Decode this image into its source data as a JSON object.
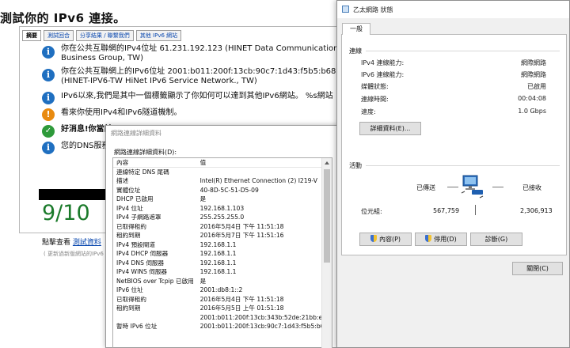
{
  "web": {
    "title": "測試你的 IPv6 連接。",
    "tabs": [
      "摘要",
      "測試回合",
      "分享結果 / 聯繫我們",
      "其他 IPv6 網站"
    ],
    "results": [
      {
        "icon": "info",
        "text": "你在公共互聯網的IPv4位址 61.231.192.123 (HINET Data Communication Business Group, TW)"
      },
      {
        "icon": "info",
        "text": "你在公共互聯網上的IPv6位址 2001:b011:200f:13cb:90c7:1d43:f5b5:b68a (HINET-IPV6-TW HiNet IPv6 Service Network., TW)"
      },
      {
        "icon": "info",
        "text": "IPv6以來,我們是其中一個標籤顯示了你如何可以達到其他IPv6網站。 %s網站"
      },
      {
        "icon": "warn",
        "text": "看來你使用IPv4和IPv6隧道機制。"
      },
      {
        "icon": "ok",
        "text": "好消息!你當前"
      },
      {
        "icon": "info",
        "text": "您的DNS服務"
      }
    ],
    "score": "9/10",
    "report_label": "點擊查看",
    "report_link": "測試資料",
    "footer_note": "( 更新過新版網站的IPv6"
  },
  "details_dialog": {
    "title": "網路連線詳細資料",
    "label": "網路連線詳細資料(D):",
    "columns": {
      "key": "內容",
      "value": "值"
    },
    "rows": [
      {
        "k": "連線特定 DNS 尾碼",
        "v": ""
      },
      {
        "k": "描述",
        "v": "Intel(R) Ethernet Connection (2) I219-V"
      },
      {
        "k": "實體位址",
        "v": "40-8D-5C-51-D5-09"
      },
      {
        "k": "DHCP 已啟用",
        "v": "是"
      },
      {
        "k": "IPv4 位址",
        "v": "192.168.1.103"
      },
      {
        "k": "IPv4 子網路遮罩",
        "v": "255.255.255.0"
      },
      {
        "k": "已取得租約",
        "v": "2016年5月4日 下午 11:51:18"
      },
      {
        "k": "租約到期",
        "v": "2016年5月7日 下午 11:51:16"
      },
      {
        "k": "IPv4 預設閘道",
        "v": "192.168.1.1"
      },
      {
        "k": "IPv4 DHCP 伺服器",
        "v": "192.168.1.1"
      },
      {
        "k": "IPv4 DNS 伺服器",
        "v": "192.168.1.1"
      },
      {
        "k": "IPv4 WINS 伺服器",
        "v": "192.168.1.1"
      },
      {
        "k": "NetBIOS over Tcpip 已啟用",
        "v": "是"
      },
      {
        "k": "IPv6 位址",
        "v": "2001:db8:1::2"
      },
      {
        "k": "已取得租約",
        "v": "2016年5月4日 下午 11:51:18"
      },
      {
        "k": "租約到期",
        "v": "2016年5月5日 上午 01:51:18"
      },
      {
        "k": "",
        "v": "2001:b011:200f:13cb:343b:52de:21bb:e"
      },
      {
        "k": "暫時 IPv6 位址",
        "v": "2001:b011:200f:13cb:90c7:1d43:f5b5:b6"
      }
    ]
  },
  "status_window": {
    "title": "乙太網路 狀態",
    "tab": "一般",
    "connection_group": "連線",
    "connection": [
      {
        "k": "IPv4 連線能力:",
        "v": "網際網路"
      },
      {
        "k": "IPv6 連線能力:",
        "v": "網際網路"
      },
      {
        "k": "媒體狀態:",
        "v": "已啟用"
      },
      {
        "k": "連線時間:",
        "v": "00:04:08"
      },
      {
        "k": "速度:",
        "v": "1.0 Gbps"
      }
    ],
    "details_button": "詳細資料(E)...",
    "activity_group": "活動",
    "sent_label": "已傳送",
    "received_label": "已接收",
    "bytes_label": "位元組:",
    "bytes_sent": "567,759",
    "bytes_received": "2,306,913",
    "buttons": {
      "properties": "內容(P)",
      "disable": "停用(D)",
      "diagnose": "診斷(G)",
      "close": "關閉(C)"
    }
  }
}
